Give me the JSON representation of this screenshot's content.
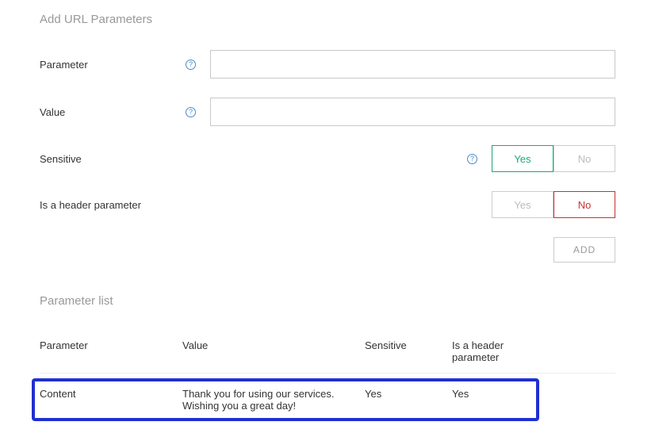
{
  "section_title": "Add URL Parameters",
  "form": {
    "parameter_label": "Parameter",
    "parameter_value": "",
    "value_label": "Value",
    "value_value": "",
    "sensitive_label": "Sensitive",
    "isheader_label": "Is a header parameter",
    "yes_label": "Yes",
    "no_label": "No",
    "add_label": "ADD"
  },
  "list_title": "Parameter list",
  "table": {
    "headers": {
      "parameter": "Parameter",
      "value": "Value",
      "sensitive": "Sensitive",
      "isheader": "Is a header parameter"
    },
    "rows": [
      {
        "parameter": "Content",
        "value": "Thank you for using our services. Wishing you a great day!",
        "sensitive": "Yes",
        "isheader": "Yes"
      }
    ]
  }
}
